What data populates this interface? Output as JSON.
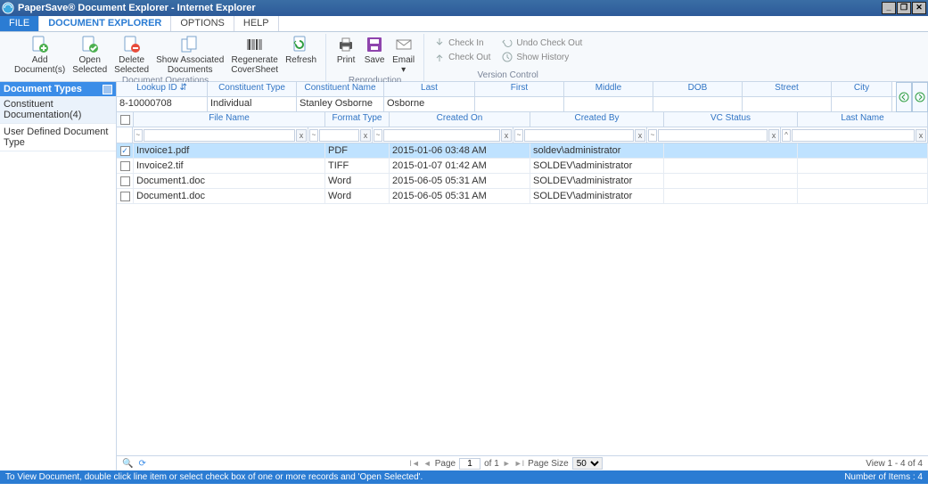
{
  "window": {
    "title": "PaperSave® Document Explorer - Internet Explorer"
  },
  "menu": {
    "file": "FILE",
    "docexp": "DOCUMENT EXPLORER",
    "options": "OPTIONS",
    "help": "HELP"
  },
  "ribbon": {
    "add": "Add\nDocument(s)",
    "open": "Open\nSelected",
    "delete": "Delete\nSelected",
    "showassoc": "Show Associated\nDocuments",
    "regen": "Regenerate\nCoverSheet",
    "refresh": "Refresh",
    "docops": "Document Operations",
    "print": "Print",
    "save": "Save",
    "email": "Email\n▾",
    "repro": "Reproduction",
    "checkin": "Check In",
    "checkout": "Check Out",
    "undock": "Undo Check Out",
    "showhist": "Show History",
    "vc": "Version Control"
  },
  "left": {
    "header": "Document Types",
    "item1": "Constituent Documentation(4)",
    "item2": "User Defined Document Type"
  },
  "lookup": {
    "hdr": {
      "lookupid": "Lookup ID ⇵",
      "ctype": "Constituent Type",
      "cname": "Constituent Name",
      "last": "Last",
      "first": "First",
      "middle": "Middle",
      "dob": "DOB",
      "street": "Street",
      "city": "City"
    },
    "row": {
      "lookupid": "8-10000708",
      "ctype": "Individual",
      "cname": "Stanley Osborne",
      "last": "Osborne",
      "first": "Stanley",
      "middle": "",
      "dob": "",
      "street": "",
      "city": ""
    }
  },
  "grid": {
    "hdr": {
      "fname": "File Name",
      "ftype": "Format Type",
      "created": "Created On",
      "cby": "Created By",
      "vc": "VC Status",
      "lname": "Last Name"
    },
    "rows": [
      {
        "checked": true,
        "fname": "Invoice1.pdf",
        "ftype": "PDF",
        "created": "2015-01-06 03:48 AM",
        "cby": "soldev\\administrator",
        "vc": "",
        "lname": ""
      },
      {
        "checked": false,
        "fname": "Invoice2.tif",
        "ftype": "TIFF",
        "created": "2015-01-07 01:42 AM",
        "cby": "SOLDEV\\administrator",
        "vc": "",
        "lname": ""
      },
      {
        "checked": false,
        "fname": "Document1.doc",
        "ftype": "Word",
        "created": "2015-06-05 05:31 AM",
        "cby": "SOLDEV\\administrator",
        "vc": "",
        "lname": ""
      },
      {
        "checked": false,
        "fname": "Document1.doc",
        "ftype": "Word",
        "created": "2015-06-05 05:31 AM",
        "cby": "SOLDEV\\administrator",
        "vc": "",
        "lname": ""
      }
    ]
  },
  "pager": {
    "page_label": "Page",
    "page_value": "1",
    "of_label": "of 1",
    "size_label": "Page Size",
    "size_value": "50",
    "view_label": "View 1 - 4 of 4"
  },
  "status": {
    "left": "To View Document, double click line item or select check box of one or more records and 'Open Selected'.",
    "right": "Number of Items : 4"
  }
}
